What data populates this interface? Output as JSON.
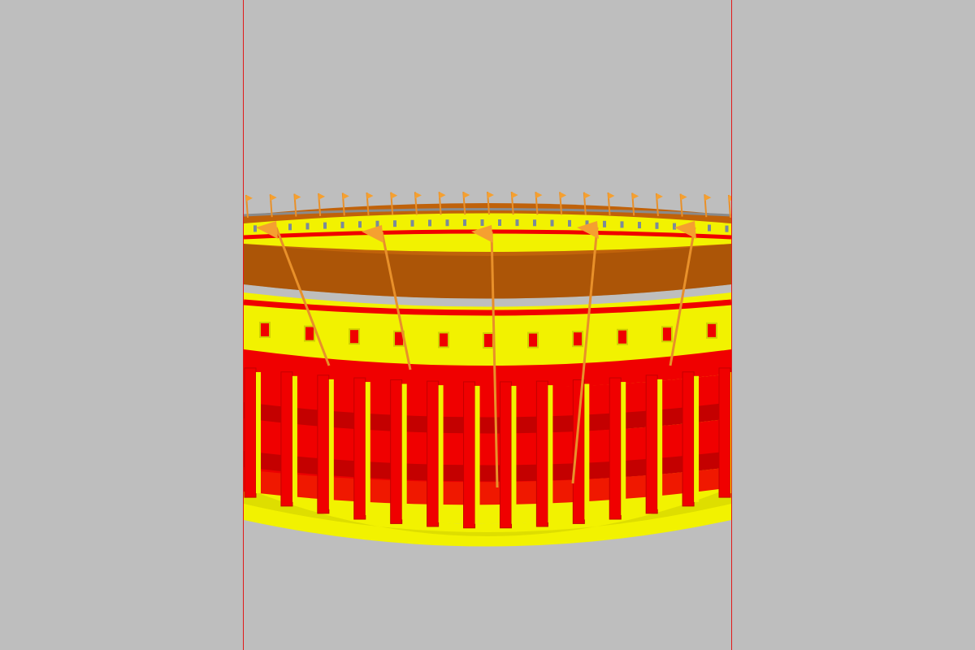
{
  "viewport": {
    "background_color": "#bebebe",
    "guide_line_color": "#e11a1a"
  },
  "model": {
    "description_icon": "colosseum-model",
    "colors": {
      "wall_yellow": "#f2f200",
      "wall_yellow_shadow": "#d1d100",
      "band_red": "#f00000",
      "band_red_dark": "#c40000",
      "awning_brown": "#c0620a",
      "awning_brown_dark": "#9a4a05",
      "flag_orange": "#f5a030",
      "pole_orange": "#e8902a",
      "rim_gray": "#8a8a8a"
    },
    "flag_count": 21,
    "pier_count": 14
  }
}
